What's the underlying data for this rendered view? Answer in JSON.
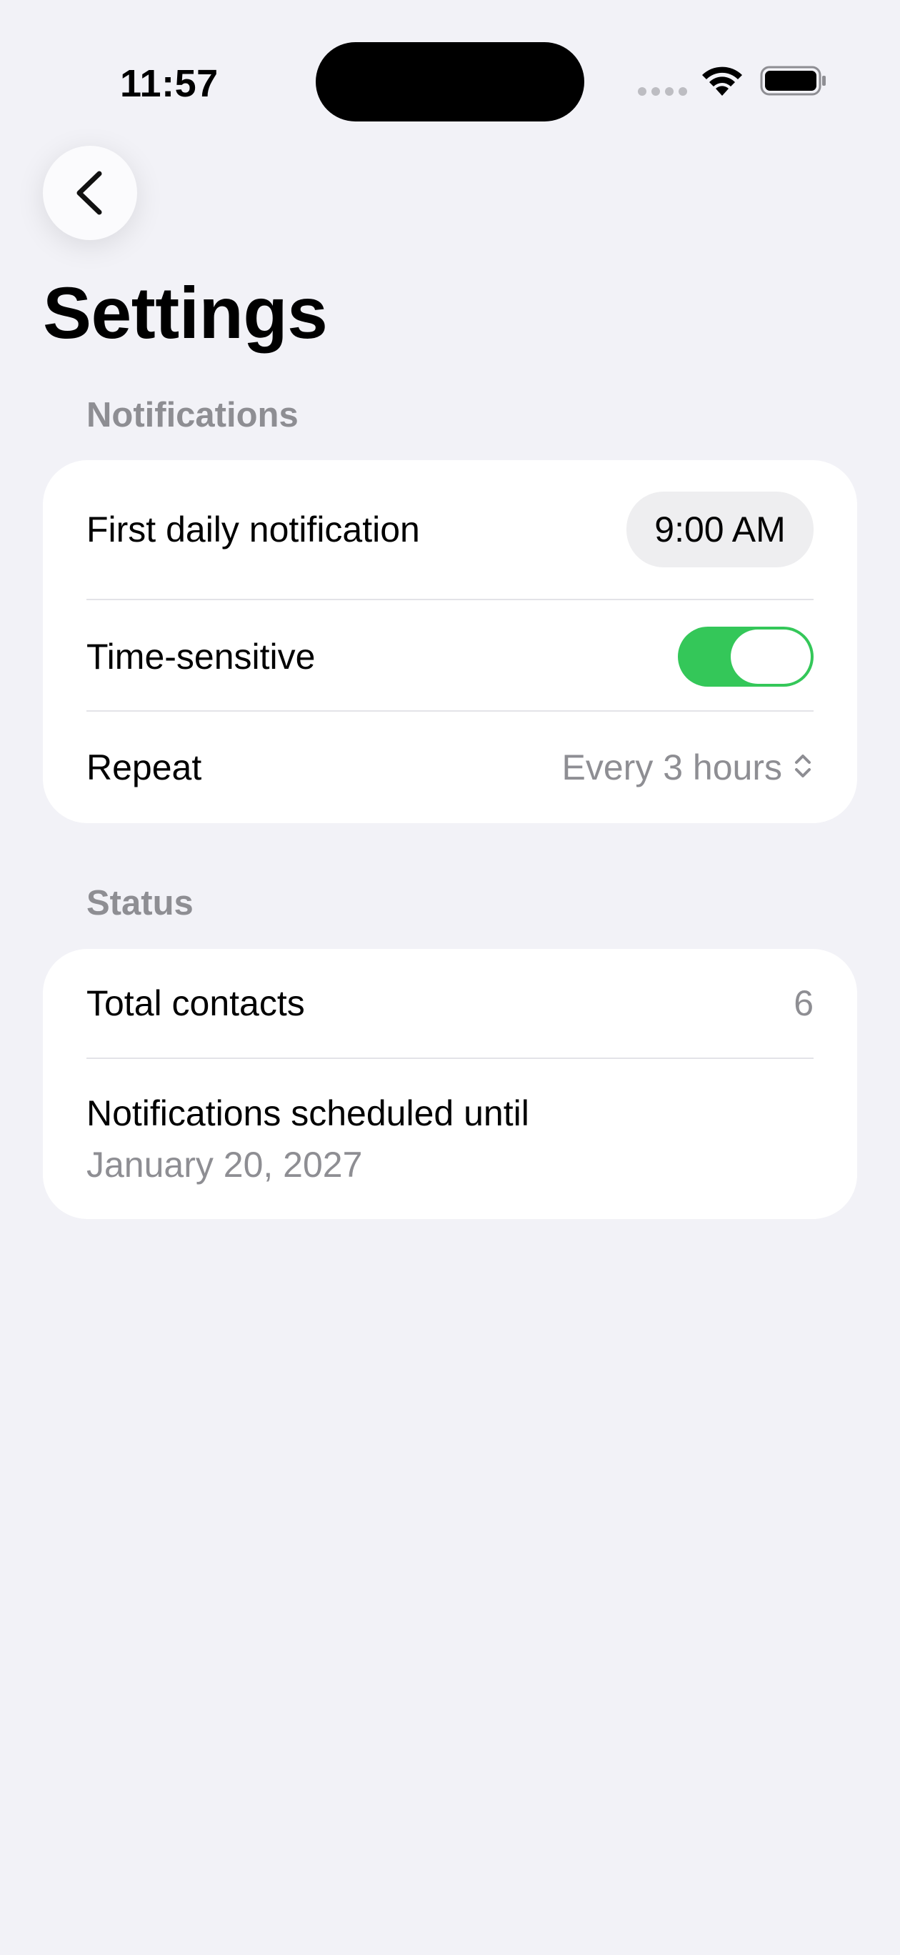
{
  "status_bar": {
    "time": "11:57"
  },
  "nav": {
    "back_icon": "chevron-left-icon"
  },
  "page": {
    "title": "Settings"
  },
  "notifications_section": {
    "header": "Notifications",
    "first_daily_label": "First daily notification",
    "first_daily_time": "9:00 AM",
    "time_sensitive_label": "Time-sensitive",
    "time_sensitive_on": true,
    "repeat_label": "Repeat",
    "repeat_value": "Every 3 hours"
  },
  "status_section": {
    "header": "Status",
    "total_contacts_label": "Total contacts",
    "total_contacts_value": "6",
    "scheduled_until_label": "Notifications scheduled until",
    "scheduled_until_value": "January 20, 2027"
  },
  "colors": {
    "background": "#F2F2F7",
    "toggle_on": "#34C759",
    "secondary_text": "#8E8E93"
  }
}
